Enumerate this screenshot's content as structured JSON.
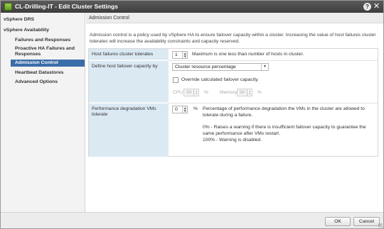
{
  "window": {
    "title": "CL-Drilling-IT - Edit Cluster Settings",
    "help_label": "?",
    "close_label": "✕"
  },
  "sidebar": {
    "items": [
      {
        "label": "vSphere DRS"
      },
      {
        "label": "vSphere Availability"
      },
      {
        "label": "Failures and Responses"
      },
      {
        "label": "Proactive HA Failures and Responses"
      },
      {
        "label": "Admission Control",
        "selected": true
      },
      {
        "label": "Heartbeat Datastores"
      },
      {
        "label": "Advanced Options"
      }
    ]
  },
  "section": {
    "title": "Admission Control",
    "description": "Admission control is a policy used by vSphere HA to ensure failover capacity within a cluster. Increasing the value of host failures cluster tolerates will increase the availability constraints and capacity reserved."
  },
  "form": {
    "host_failures": {
      "label": "Host failures cluster tolerates",
      "value": "1",
      "hint": "Maximum is one less than number of hosts in cluster."
    },
    "failover_capacity": {
      "label": "Define host failover capacity by",
      "selected": "Cluster resource percentage",
      "override_label": "Override calculated failover capacity.",
      "override_checked": false,
      "cpu_label": "CPU",
      "cpu_value": "50",
      "cpu_unit": "%",
      "memory_label": "Memory",
      "memory_value": "50",
      "memory_unit": "%"
    },
    "performance": {
      "label": "Performance degradation VMs tolerate",
      "value": "0",
      "unit": "%",
      "help_line1": "Percentage of performance degradation the VMs in the cluster are allowed to tolerate during a failure.",
      "help_line2": "0% - Raises a warning if there is insufficient failover capacity to guarantee the same performance after VMs restart.",
      "help_line3": "100% - Warning is disabled."
    }
  },
  "footer": {
    "ok_label": "OK",
    "cancel_label": "Cancel"
  },
  "icons": {
    "spin_up": "▲",
    "spin_down": "▼",
    "caret": "▼"
  },
  "colors": {
    "selection": "#3a6ea8",
    "label_cell": "#dbe9f3",
    "titlebar": "#4a4a4a"
  }
}
